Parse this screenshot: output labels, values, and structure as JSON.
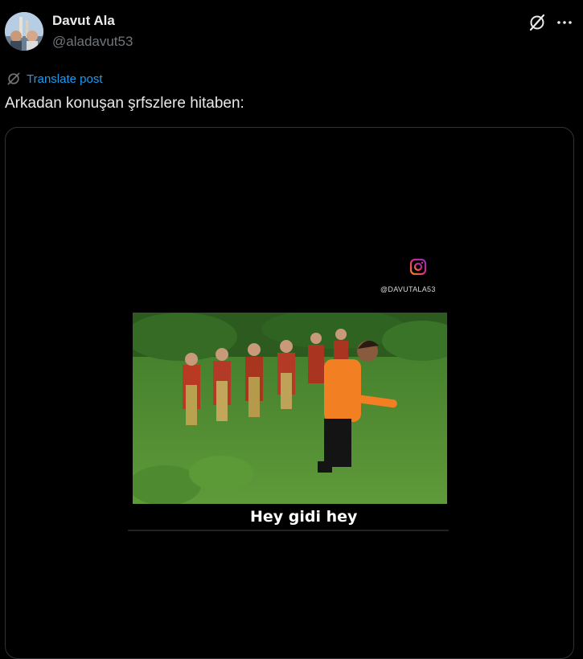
{
  "author": {
    "name": "Davut Ala",
    "handle": "@aladavut53",
    "avatar_icon": "avatar-photo"
  },
  "header_icons": {
    "grok": "grok-icon",
    "more": "more-icon"
  },
  "translate": {
    "icon": "translate-icon",
    "label": "Translate post"
  },
  "post": {
    "text": "Arkadan konuşan şrfszlere hitaben:"
  },
  "video": {
    "watermark": "@DAVUTALA53",
    "instagram_icon": "instagram-icon",
    "caption": "Hey gidi hey"
  },
  "colors": {
    "background": "#000000",
    "text": "#e7e9ea",
    "muted": "#71767b",
    "link": "#1d9bf0",
    "border": "#2f3336"
  }
}
